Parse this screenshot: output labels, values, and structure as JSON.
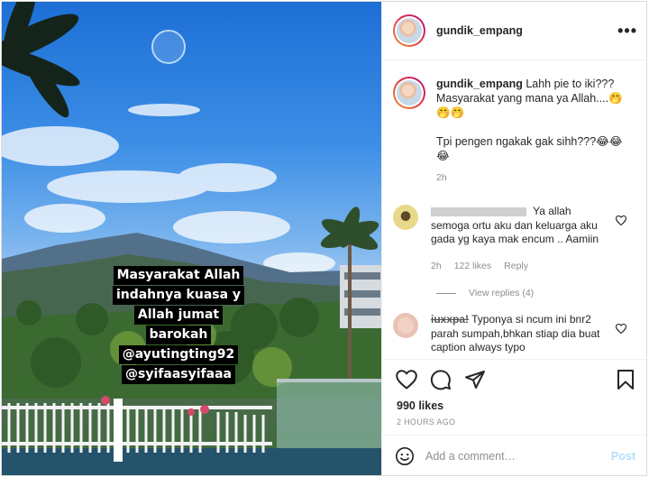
{
  "post": {
    "username": "gundik_empang",
    "more_icon": "more-icon",
    "caption_user": "gundik_empang",
    "caption": "Lahh pie to iki??? Masyarakat yang mana ya Allah....🤭🤭🤭\n\nTpi pengen ngakak gak sihh???😂😂😂",
    "caption_time": "2h",
    "media_overlay": [
      "Masyarakat Allah",
      "indahnya kuasa y",
      "Allah jumat",
      "barokah",
      "@ayutingting92",
      "@syifaasyifaaa"
    ]
  },
  "comments": [
    {
      "username_redacted": true,
      "text": "Ya allah semoga ortu aku dan keluarga aku gada yg kaya mak encum .. Aamiin",
      "time": "2h",
      "likes": "122 likes",
      "reply": "Reply",
      "view_replies": "View replies (4)"
    },
    {
      "username": "iuxxpa!",
      "text": "Typonya si ncum ini bnr2 parah sumpah,bhkan stiap dia buat caption always typo"
    }
  ],
  "actions": {
    "likes": "990 likes",
    "date": "2 HOURS AGO",
    "comment_placeholder": "Add a comment…",
    "post_label": "Post"
  },
  "colors": {
    "accent": "#0095f6",
    "post_disabled": "#b2dffc",
    "muted": "#8e8e8e"
  }
}
